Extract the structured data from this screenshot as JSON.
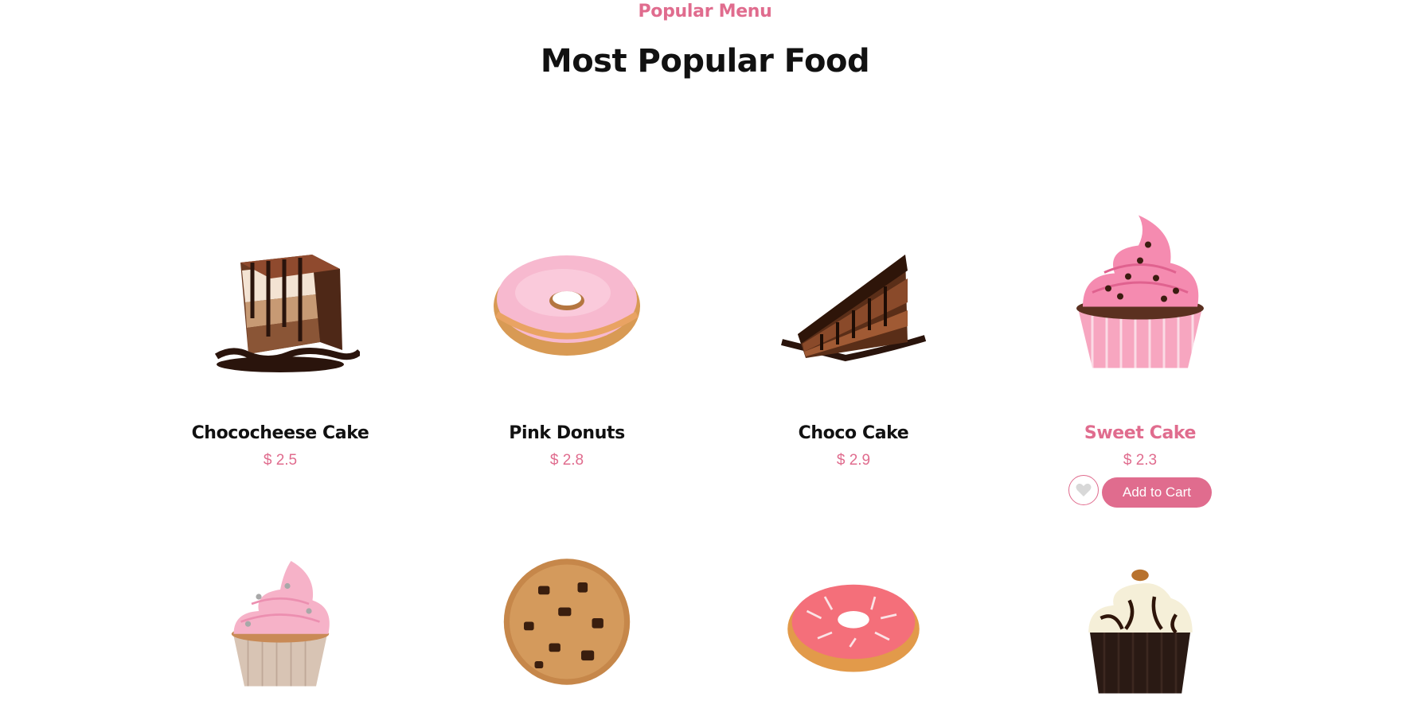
{
  "header": {
    "kicker": "Popular Menu",
    "title": "Most Popular Food"
  },
  "colors": {
    "accent": "#e06c8e",
    "text": "#111111",
    "background": "#ffffff"
  },
  "items": [
    {
      "name": "Chococheese Cake",
      "price": "$ 2.5",
      "image": "layered-chocolate-cheesecake"
    },
    {
      "name": "Pink Donuts",
      "price": "$ 2.8",
      "image": "pink-glazed-donut"
    },
    {
      "name": "Choco Cake",
      "price": "$ 2.9",
      "image": "chocolate-cake-slice"
    },
    {
      "name": "Sweet Cake",
      "price": "$ 2.3",
      "image": "pink-frosted-cupcake",
      "active": true,
      "actions": {
        "cart_label": "Add to Cart",
        "like_icon": "heart-icon"
      }
    },
    {
      "image": "pink-swirl-cupcake"
    },
    {
      "image": "chocolate-chip-cookie"
    },
    {
      "image": "strawberry-drizzle-donut"
    },
    {
      "image": "chocolate-cream-cupcake"
    }
  ]
}
